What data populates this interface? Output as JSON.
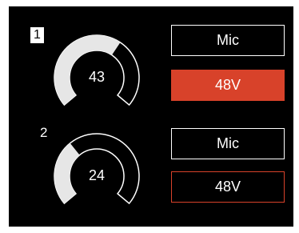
{
  "channels": [
    {
      "label": "1",
      "gain": "43",
      "gain_level": 0.63,
      "mode_label": "Mic",
      "phantom_label": "48V",
      "phantom_active": true
    },
    {
      "label": "2",
      "gain": "24",
      "gain_level": 0.35,
      "mode_label": "Mic",
      "phantom_label": "48V",
      "phantom_active": false
    }
  ],
  "colors": {
    "accent": "#d8422a",
    "arc_fill": "#e6e6e6",
    "background": "#000000",
    "text": "#ffffff"
  }
}
